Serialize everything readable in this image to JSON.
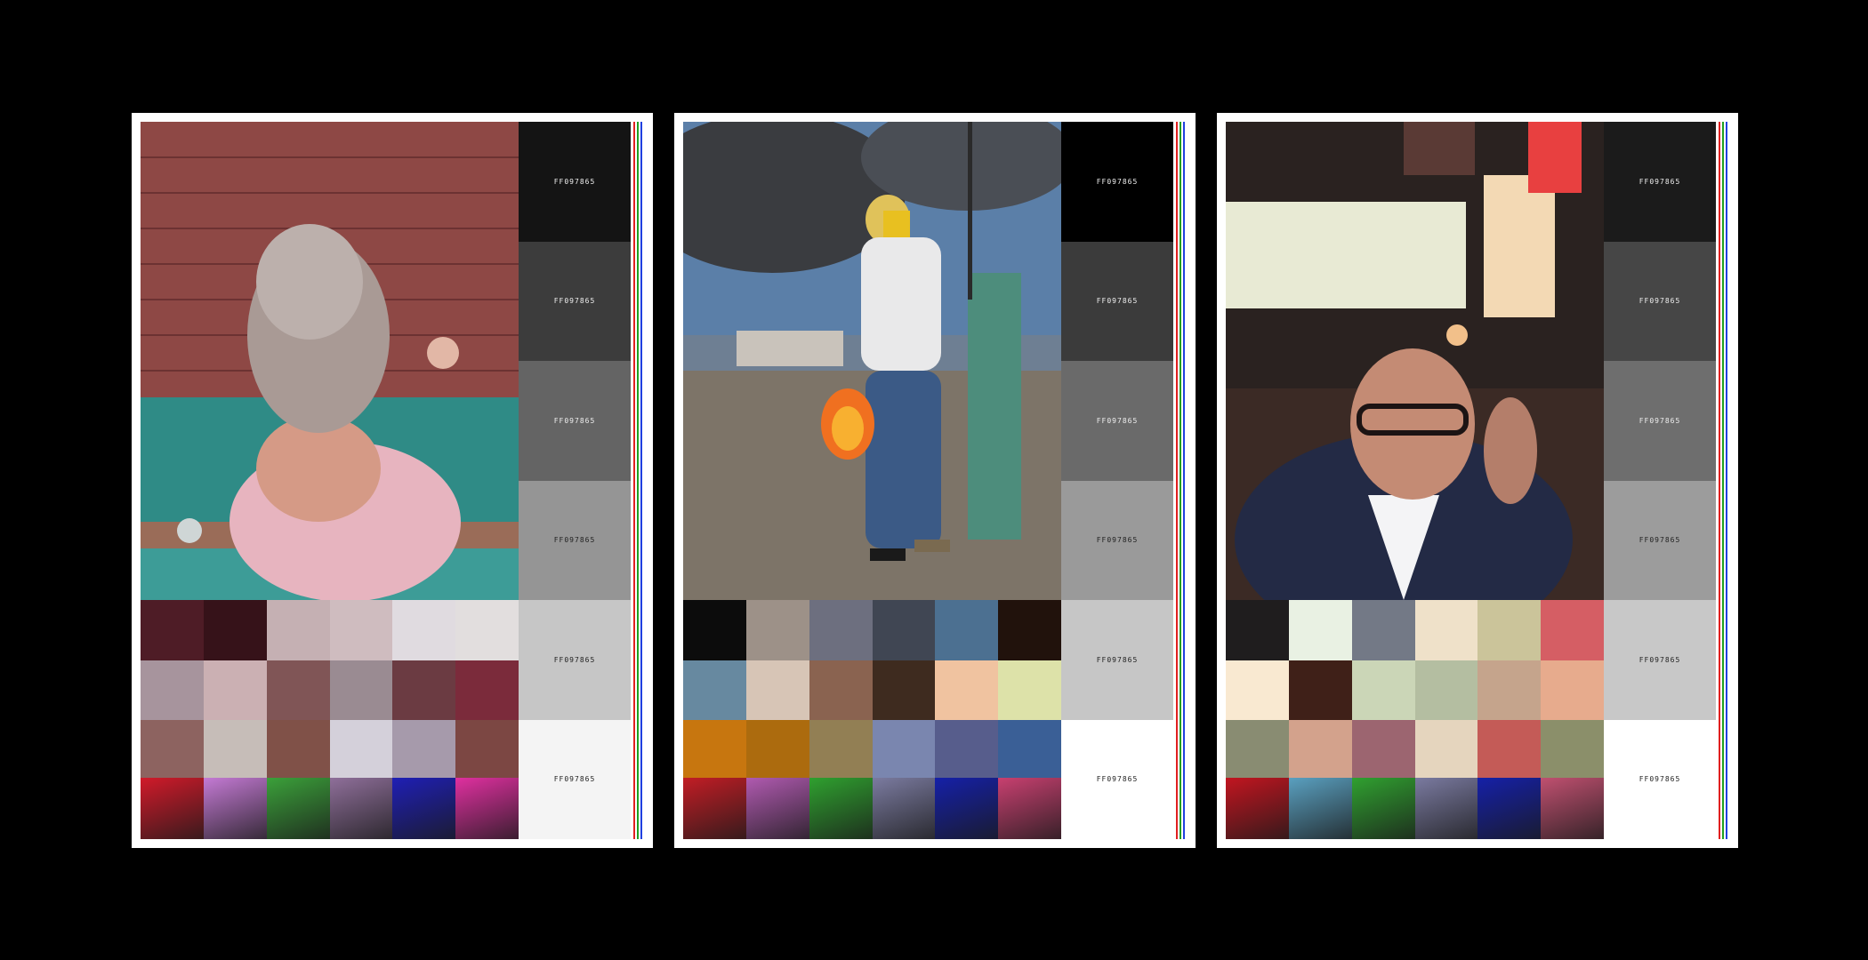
{
  "cards": [
    {
      "photo_alt": "",
      "gray_label": "FF097865",
      "grays": [
        "#141414",
        "#3c3c3c",
        "#646464",
        "#959595",
        "#c6c6c6",
        "#f4f4f4"
      ],
      "palette": [
        "#4e1c26",
        "#361219",
        "#c5b0b3",
        "#cfbcbf",
        "#e0dbe0",
        "#e2dede",
        "#a7949d",
        "#cbb0b3",
        "#805556",
        "#9a8b92",
        "#6b3b42",
        "#7b2b3b",
        "#8d6360",
        "#c6bdb8",
        "#805148",
        "#d4d0da",
        "#a69aab",
        "#7c4743"
      ],
      "thumbs": [
        "#d11a2a",
        "#c47ad4",
        "#3ba03a",
        "#8f6f9a",
        "#1f1fb5",
        "#e030a0"
      ],
      "stripes": [
        "#e02020",
        "#20a020",
        "#2040e0"
      ]
    },
    {
      "photo_alt": "",
      "gray_label": "FF097865",
      "grays": [
        "#000000",
        "#3b3b3b",
        "#6a6a6a",
        "#9a9a9a",
        "#c6c6c6",
        "#ffffff"
      ],
      "palette": [
        "#0c0c0c",
        "#9d9188",
        "#6d6f7f",
        "#404653",
        "#4c7091",
        "#21120c",
        "#6789a0",
        "#d7c5b6",
        "#8a6350",
        "#3e2b1f",
        "#f0c3a0",
        "#dde2a9",
        "#c7760f",
        "#ac6b0e",
        "#927f54",
        "#7a86af",
        "#575d8c",
        "#3a5f96"
      ],
      "thumbs": [
        "#c21d25",
        "#b05ab0",
        "#2fa02f",
        "#7b7ba0",
        "#1520a8",
        "#c84070"
      ],
      "stripes": [
        "#e02020",
        "#20a020",
        "#2040e0"
      ]
    },
    {
      "photo_alt": "",
      "gray_label": "FF097865",
      "grays": [
        "#1b1b1b",
        "#464646",
        "#6e6e6e",
        "#9c9c9c",
        "#c8c8c8",
        "#ffffff"
      ],
      "palette": [
        "#1f1d1e",
        "#e9f1e3",
        "#737986",
        "#efe1c9",
        "#cbc49a",
        "#d55e64",
        "#f9e9d1",
        "#3f2018",
        "#cbd6b7",
        "#b4bea1",
        "#c5a48c",
        "#e7ab8d",
        "#898c72",
        "#d3a28c",
        "#9c6570",
        "#e5d5be",
        "#c45b57",
        "#8b8f6a"
      ],
      "thumbs": [
        "#c21520",
        "#5aa0c0",
        "#30a030",
        "#7a7aa0",
        "#1520a8",
        "#c05070"
      ],
      "stripes": [
        "#e02020",
        "#20a020",
        "#2040e0"
      ]
    }
  ]
}
